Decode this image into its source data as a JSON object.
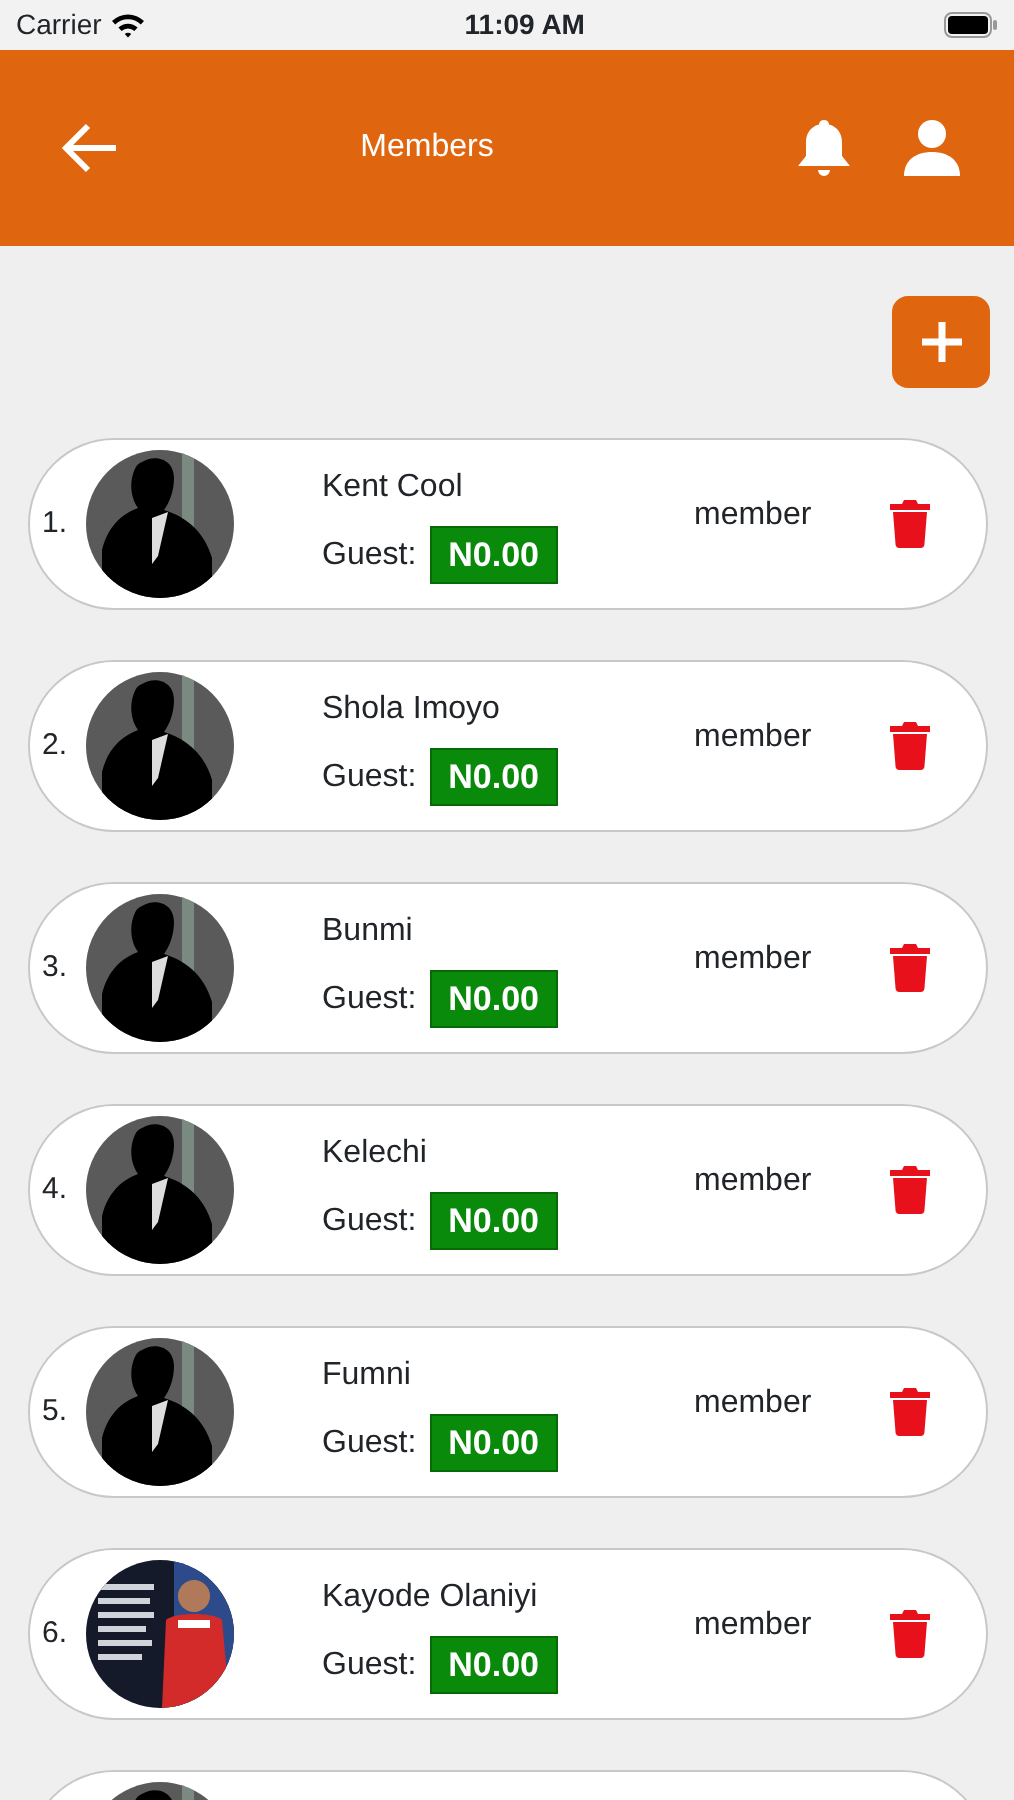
{
  "status_bar": {
    "carrier": "Carrier",
    "time": "11:09 AM"
  },
  "header": {
    "title": "Members"
  },
  "members": [
    {
      "number": "1.",
      "avatar": {
        "kind": "silhouette"
      },
      "name": "Kent Cool",
      "guest_label": "Guest:",
      "balance": "N0.00",
      "role": "member"
    },
    {
      "number": "2.",
      "avatar": {
        "kind": "silhouette"
      },
      "name": "Shola Imoyo",
      "guest_label": "Guest:",
      "balance": "N0.00",
      "role": "member"
    },
    {
      "number": "3.",
      "avatar": {
        "kind": "silhouette"
      },
      "name": "Bunmi",
      "guest_label": "Guest:",
      "balance": "N0.00",
      "role": "member"
    },
    {
      "number": "4.",
      "avatar": {
        "kind": "silhouette"
      },
      "name": "Kelechi",
      "guest_label": "Guest:",
      "balance": "N0.00",
      "role": "member"
    },
    {
      "number": "5.",
      "avatar": {
        "kind": "silhouette"
      },
      "name": "Fumni",
      "guest_label": "Guest:",
      "balance": "N0.00",
      "role": "member"
    },
    {
      "number": "6.",
      "name": "Kayode Olaniyi",
      "guest_label": "Guest:",
      "balance": "N0.00",
      "role": "member"
    },
    {
      "avatar": {
        "kind": "silhouette"
      }
    }
  ]
}
